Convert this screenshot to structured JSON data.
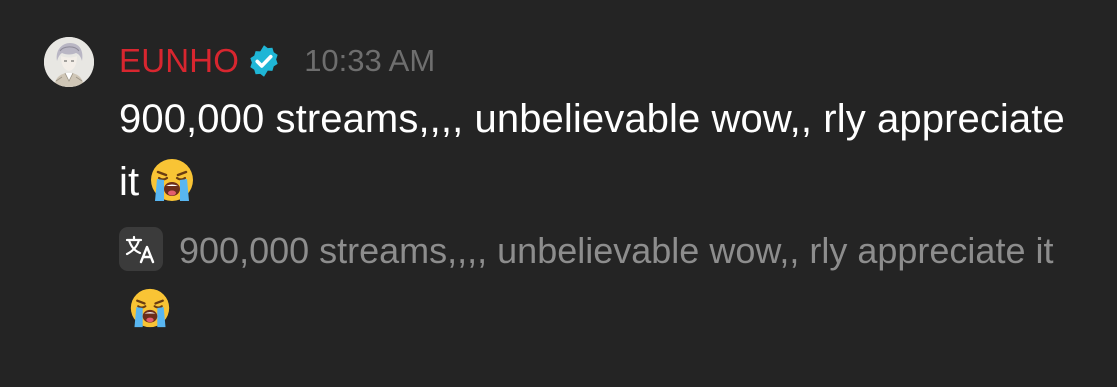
{
  "message": {
    "username": "EUNHO",
    "timestamp": "10:33 AM",
    "text": "900,000 streams,,,, unbelievable wow,, rly appreciate it",
    "translation": "900,000 streams,,,, unbelievable wow,, rly appreciate it",
    "emoji": "loudly-crying-face",
    "avatar": "user-avatar",
    "verified": true
  },
  "colors": {
    "background": "#242424",
    "username": "#d8262f",
    "verified": "#1fb6d6",
    "timestamp": "#6e6e6e",
    "text": "#ffffff",
    "translation": "#8d8d8d"
  }
}
